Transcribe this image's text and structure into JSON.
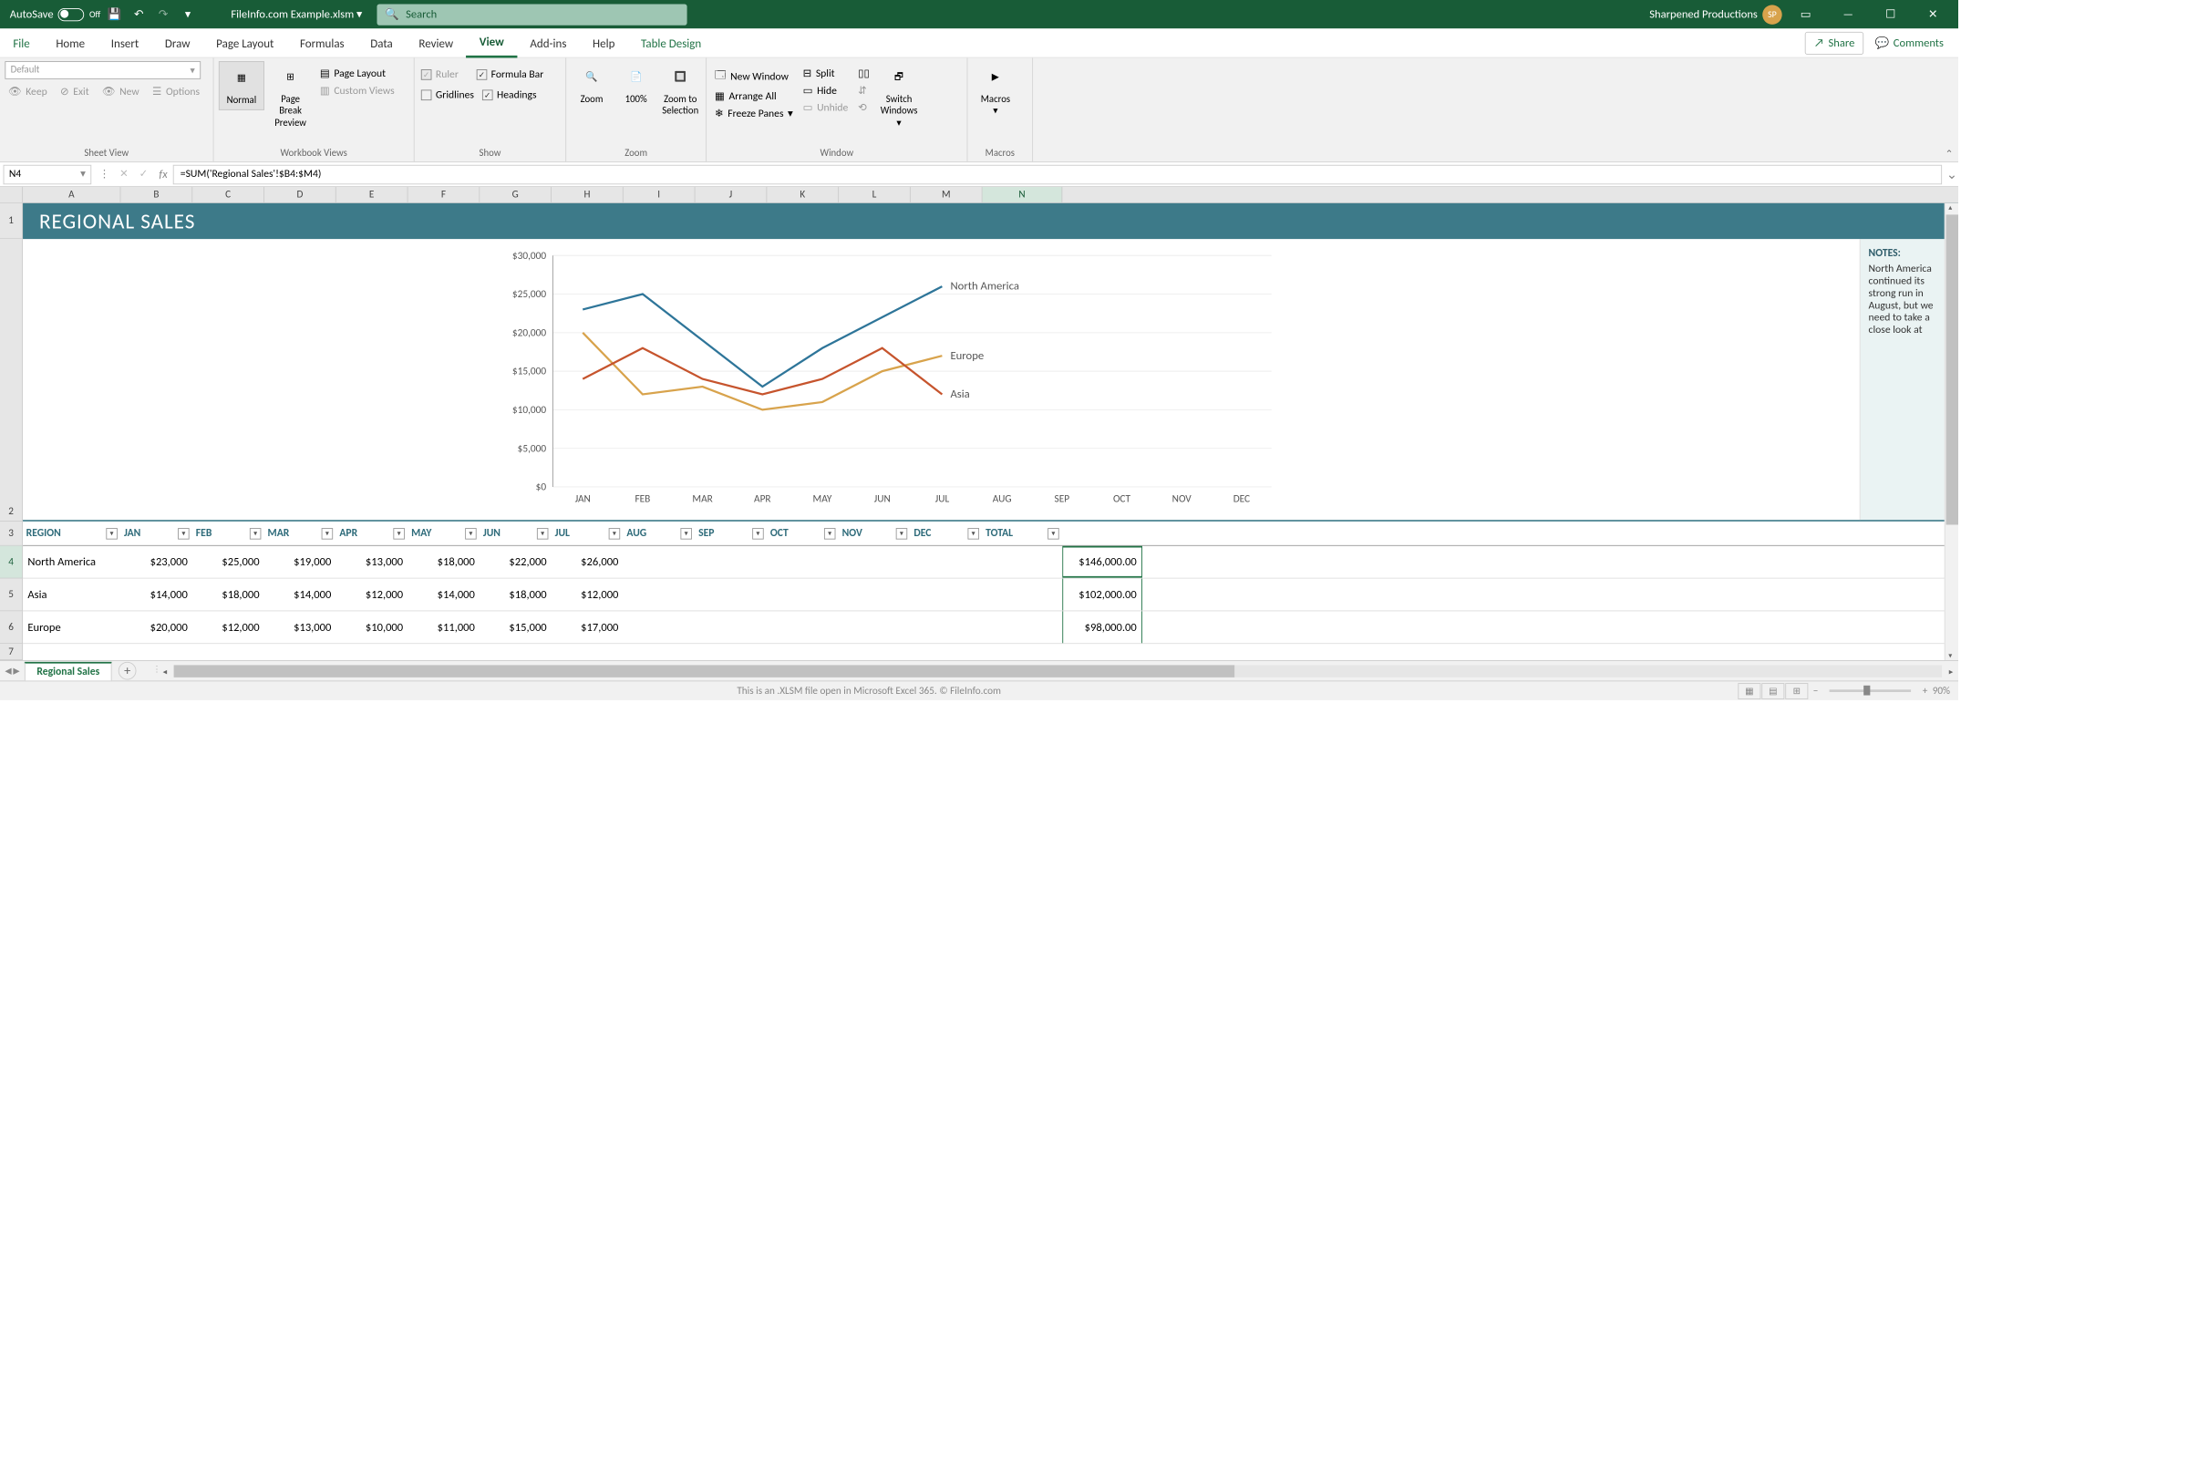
{
  "titlebar": {
    "autosave": "AutoSave",
    "autosave_state": "Off",
    "filename": "FileInfo.com Example.xlsm",
    "search_placeholder": "Search",
    "account": "Sharpened Productions",
    "account_initials": "SP"
  },
  "tabs": [
    "File",
    "Home",
    "Insert",
    "Draw",
    "Page Layout",
    "Formulas",
    "Data",
    "Review",
    "View",
    "Add-ins",
    "Help",
    "Table Design"
  ],
  "active_tab": "View",
  "share": "Share",
  "comments": "Comments",
  "ribbon": {
    "sheetview": {
      "label": "Sheet View",
      "default": "Default",
      "keep": "Keep",
      "exit": "Exit",
      "new": "New",
      "options": "Options"
    },
    "workbookviews": {
      "label": "Workbook Views",
      "normal": "Normal",
      "pagebreak": "Page Break Preview",
      "pagelayout": "Page Layout",
      "customviews": "Custom Views"
    },
    "show": {
      "label": "Show",
      "ruler": "Ruler",
      "gridlines": "Gridlines",
      "formulabar": "Formula Bar",
      "headings": "Headings"
    },
    "zoom": {
      "label": "Zoom",
      "zoom": "Zoom",
      "hundred": "100%",
      "zts": "Zoom to Selection"
    },
    "window": {
      "label": "Window",
      "newwindow": "New Window",
      "arrange": "Arrange All",
      "freeze": "Freeze Panes",
      "split": "Split",
      "hide": "Hide",
      "unhide": "Unhide",
      "switch": "Switch Windows"
    },
    "macros": {
      "label": "Macros",
      "macros": "Macros"
    }
  },
  "namebox": "N4",
  "formula": "=SUM('Regional Sales'!$B4:$M4)",
  "columns": [
    "A",
    "B",
    "C",
    "D",
    "E",
    "F",
    "G",
    "H",
    "I",
    "J",
    "K",
    "L",
    "M",
    "N"
  ],
  "rows": [
    "1",
    "2",
    "3",
    "4",
    "5",
    "6",
    "7"
  ],
  "banner": "REGIONAL SALES",
  "notes": {
    "title": "NOTES:",
    "body": "North America continued its strong run in August, but we need to take a close look at"
  },
  "table": {
    "headers": [
      "REGION",
      "JAN",
      "FEB",
      "MAR",
      "APR",
      "MAY",
      "JUN",
      "JUL",
      "AUG",
      "SEP",
      "OCT",
      "NOV",
      "DEC",
      "TOTAL"
    ],
    "rows": [
      {
        "region": "North America",
        "vals": [
          "$23,000",
          "$25,000",
          "$19,000",
          "$13,000",
          "$18,000",
          "$22,000",
          "$26,000",
          "",
          "",
          "",
          "",
          "",
          ""
        ],
        "total": "$146,000.00"
      },
      {
        "region": "Asia",
        "vals": [
          "$14,000",
          "$18,000",
          "$14,000",
          "$12,000",
          "$14,000",
          "$18,000",
          "$12,000",
          "",
          "",
          "",
          "",
          "",
          ""
        ],
        "total": "$102,000.00"
      },
      {
        "region": "Europe",
        "vals": [
          "$20,000",
          "$12,000",
          "$13,000",
          "$10,000",
          "$11,000",
          "$15,000",
          "$17,000",
          "",
          "",
          "",
          "",
          "",
          ""
        ],
        "total": "$98,000.00"
      }
    ]
  },
  "chart_data": {
    "type": "line",
    "categories": [
      "JAN",
      "FEB",
      "MAR",
      "APR",
      "MAY",
      "JUN",
      "JUL",
      "AUG",
      "SEP",
      "OCT",
      "NOV",
      "DEC"
    ],
    "series": [
      {
        "name": "North America",
        "values": [
          23000,
          25000,
          19000,
          13000,
          18000,
          22000,
          26000,
          null,
          null,
          null,
          null,
          null
        ],
        "color": "#2e7599"
      },
      {
        "name": "Europe",
        "values": [
          20000,
          12000,
          13000,
          10000,
          11000,
          15000,
          17000,
          null,
          null,
          null,
          null,
          null
        ],
        "color": "#d8a34c"
      },
      {
        "name": "Asia",
        "values": [
          14000,
          18000,
          14000,
          12000,
          14000,
          18000,
          12000,
          null,
          null,
          null,
          null,
          null
        ],
        "color": "#c6542d"
      }
    ],
    "ylabel": "",
    "ylim": [
      0,
      30000
    ],
    "yticks": [
      0,
      5000,
      10000,
      15000,
      20000,
      25000,
      30000
    ],
    "ytick_labels": [
      "$0",
      "$5,000",
      "$10,000",
      "$15,000",
      "$20,000",
      "$25,000",
      "$30,000"
    ]
  },
  "sheet_tab": "Regional Sales",
  "status_text": "This is an .XLSM file open in Microsoft Excel 365. © FileInfo.com",
  "zoom": "90%"
}
